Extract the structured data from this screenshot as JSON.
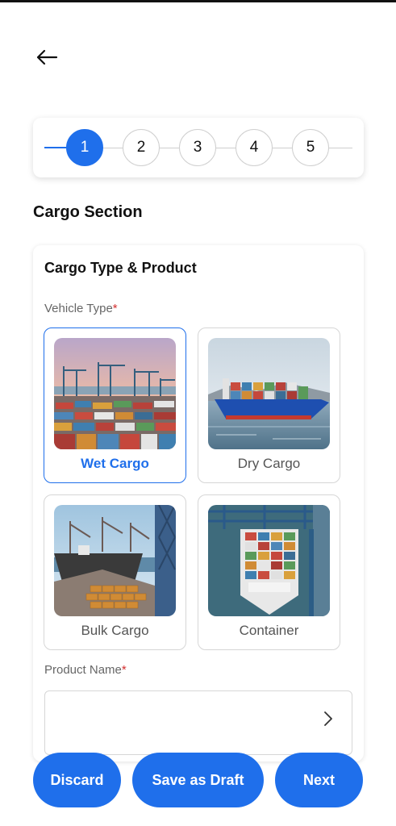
{
  "header": {
    "back_icon": "arrow-left-icon"
  },
  "stepper": {
    "active_index": 0,
    "steps": [
      {
        "label": "1"
      },
      {
        "label": "2"
      },
      {
        "label": "3"
      },
      {
        "label": "4"
      },
      {
        "label": "5"
      }
    ]
  },
  "section": {
    "title": "Cargo Section"
  },
  "card": {
    "title": "Cargo Type & Product",
    "vehicle_type": {
      "label": "Vehicle Type",
      "required_mark": "*",
      "selected": "Wet Cargo",
      "options": [
        {
          "label": "Wet Cargo",
          "image": "wet-cargo-port-image"
        },
        {
          "label": "Dry Cargo",
          "image": "dry-cargo-ship-image"
        },
        {
          "label": "Bulk Cargo",
          "image": "bulk-cargo-ship-image"
        },
        {
          "label": "Container",
          "image": "container-ship-image"
        }
      ]
    },
    "product_name": {
      "label": "Product Name",
      "required_mark": "*",
      "value": "",
      "chevron_icon": "chevron-right-icon"
    }
  },
  "footer": {
    "discard_label": "Discard",
    "draft_label": "Save as Draft",
    "next_label": "Next"
  },
  "colors": {
    "accent": "#1f6feb",
    "required": "#d32f2f"
  }
}
